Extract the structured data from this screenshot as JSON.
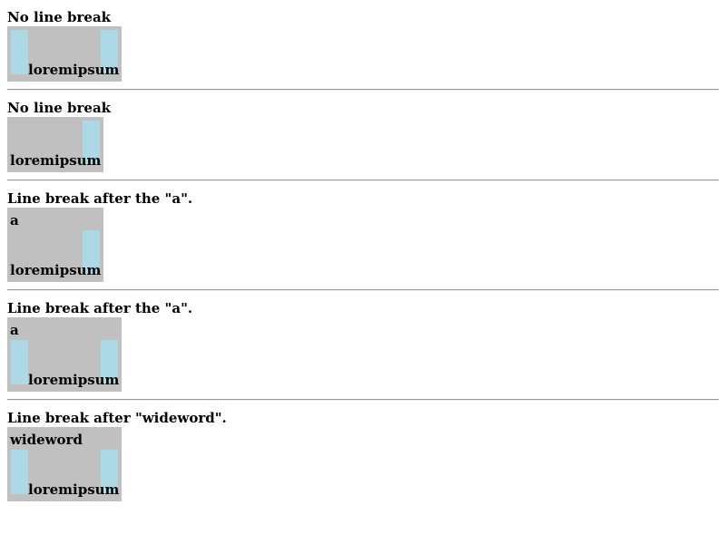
{
  "sections": [
    {
      "heading": "No line break",
      "first_word": "",
      "words": "loremipsum",
      "bars": "both"
    },
    {
      "heading": "No line break",
      "first_word": "",
      "words": "loremipsum",
      "bars": "right"
    },
    {
      "heading": "Line break after the \"a\".",
      "first_word": "a",
      "words": "loremipsum",
      "bars": "right"
    },
    {
      "heading": "Line break after the \"a\".",
      "first_word": "a",
      "words": "loremipsum",
      "bars": "both"
    },
    {
      "heading": "Line break after \"wideword\".",
      "first_word": "wideword",
      "words": "loremipsum",
      "bars": "both"
    }
  ],
  "colors": {
    "box_bg": "#c0c0c0",
    "float_bar": "#add8e6",
    "rule": "#999999"
  }
}
